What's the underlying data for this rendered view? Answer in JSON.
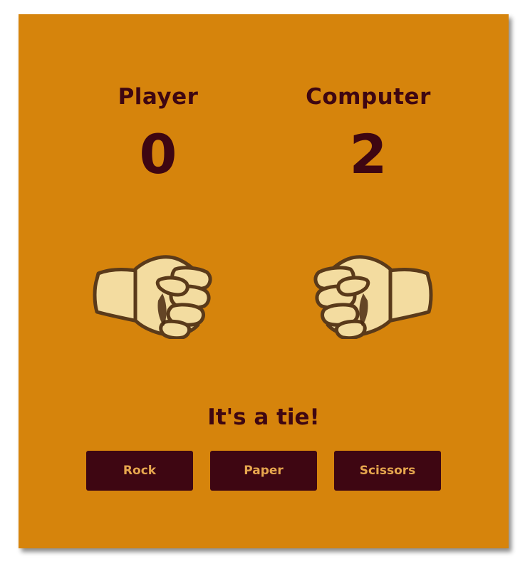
{
  "scoreboard": {
    "player": {
      "label": "Player",
      "score": "0"
    },
    "computer": {
      "label": "Computer",
      "score": "2"
    }
  },
  "hands": {
    "player": {
      "icon": "fist-icon",
      "choice": "rock"
    },
    "computer": {
      "icon": "fist-icon",
      "choice": "rock"
    }
  },
  "result": {
    "text": "It's a tie!"
  },
  "choices": {
    "rock": "Rock",
    "paper": "Paper",
    "scissors": "Scissors"
  },
  "colors": {
    "background": "#d6840c",
    "text": "#3e0612",
    "button_background": "#3e0612",
    "button_text": "#e6a64e",
    "skin": "#f3dca0",
    "skin_outline": "#5a3a1a"
  }
}
